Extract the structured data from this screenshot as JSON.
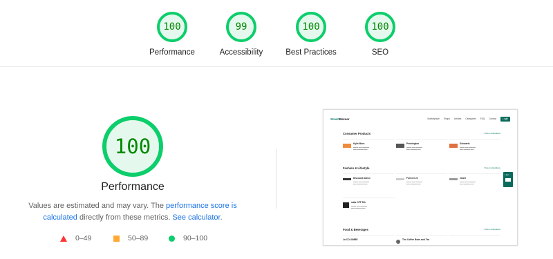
{
  "categories": [
    {
      "score": "100",
      "label": "Performance"
    },
    {
      "score": "99",
      "label": "Accessibility"
    },
    {
      "score": "100",
      "label": "Best Practices"
    },
    {
      "score": "100",
      "label": "SEO"
    }
  ],
  "performance": {
    "score": "100",
    "title": "Performance",
    "desc_prefix": "Values are estimated and may vary. The ",
    "desc_link1": "performance score is calculated",
    "desc_middle": " directly from these metrics. ",
    "desc_link2": "See calculator",
    "desc_suffix": "."
  },
  "legend": {
    "fail": "0–49",
    "average": "50–89",
    "pass": "90–100"
  },
  "colors": {
    "pass": "#0cce6b",
    "average": "#ffaa33",
    "fail": "#ff3333",
    "link": "#1a73e8"
  },
  "thumbnail": {
    "logo_a": "Smart",
    "logo_b": "Bazaar",
    "nav": [
      "Marketplace",
      "Shops",
      "Articles",
      "Categories",
      "FAQ",
      "Contact"
    ],
    "login": "Login",
    "view_more": "View marketplace",
    "side_label": "1 Item",
    "sections": [
      {
        "title": "Consumer Products",
        "items": [
          {
            "name": "Kylie Bora"
          },
          {
            "name": "Pennington"
          },
          {
            "name": "Schwartz"
          }
        ]
      },
      {
        "title": "Fashion & Lifestyle",
        "items": [
          {
            "name": "Discount Dance"
          },
          {
            "name": "Forever 21"
          },
          {
            "name": "Jewel"
          },
          {
            "name": "saks OFF 5th"
          }
        ]
      },
      {
        "title": "Food & Beverages",
        "items": [
          {
            "name": "La COLOMBE"
          },
          {
            "name": "The Coffee Bean and Tea"
          }
        ]
      }
    ]
  }
}
